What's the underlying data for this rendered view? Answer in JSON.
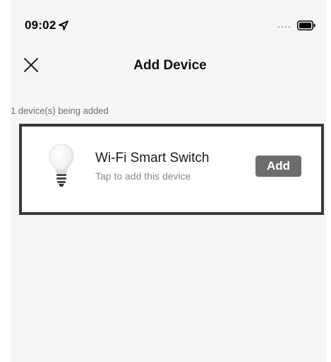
{
  "status_bar": {
    "time": "09:02",
    "icons": [
      "location-arrow-icon",
      "signal-dots-icon",
      "battery-icon"
    ]
  },
  "nav": {
    "close_icon": "close-x-icon",
    "title": "Add Device"
  },
  "section": {
    "label": "1 device(s) being added"
  },
  "device": {
    "icon": "light-bulb-icon",
    "name": "Wi-Fi Smart Switch",
    "hint": "Tap to add this device",
    "add_label": "Add"
  },
  "colors": {
    "background": "#f6f6f6",
    "card": "#ffffff",
    "highlight_border": "#3a3a3a",
    "button": "#6d6d6d",
    "secondary_text": "#8a8a8a"
  }
}
